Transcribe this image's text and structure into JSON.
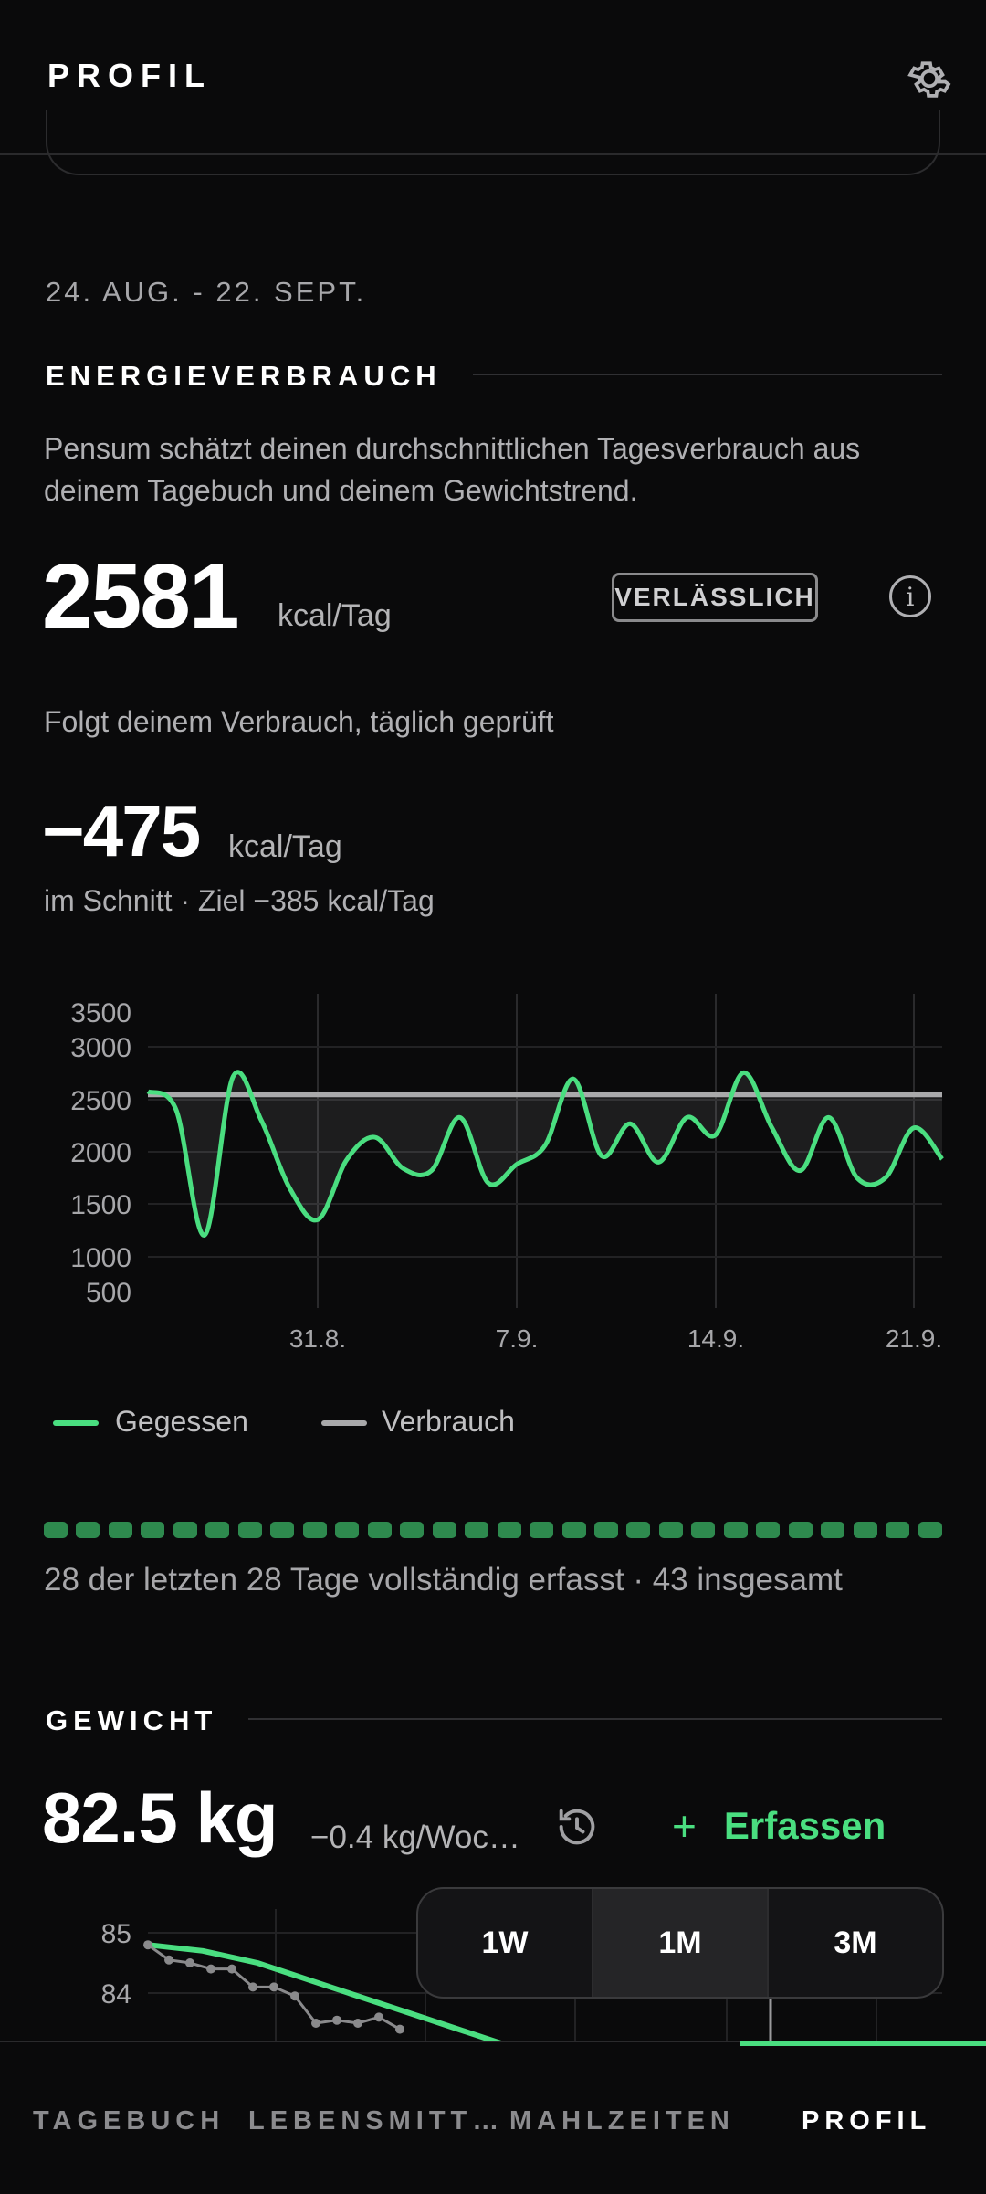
{
  "header": {
    "title": "PROFIL"
  },
  "period": {
    "range": "24. AUG. - 22. SEPT."
  },
  "energy": {
    "section_title": "ENERGIEVERBRAUCH",
    "description": "Pensum schätzt deinen durchschnittlichen Tagesverbrauch aus deinem Tagebuch und deinem Gewichtstrend.",
    "value": "2581",
    "unit": "kcal/Tag",
    "badge": "VERLÄSSLICH",
    "info_icon": "i",
    "tracking_text": "Folgt deinem Verbrauch, täglich geprüft",
    "deficit_value": "−475",
    "deficit_unit": "kcal/Tag",
    "deficit_caption": "im Schnitt · Ziel −385 kcal/Tag"
  },
  "chart_data": [
    {
      "type": "line",
      "y_ticks": [
        "3500",
        "3000",
        "2500",
        "2000",
        "1500",
        "1000",
        "500"
      ],
      "x_ticks": [
        "31.8.",
        "7.9.",
        "14.9.",
        "21.9."
      ],
      "series": [
        {
          "name": "Gegessen",
          "color": "#4ade80",
          "values": [
            2580,
            2400,
            1200,
            2720,
            2300,
            1650,
            1350,
            1920,
            2140,
            1840,
            1820,
            2330,
            1700,
            1880,
            2060,
            2700,
            1960,
            2270,
            1900,
            2330,
            2160,
            2760,
            2230,
            1820,
            2330,
            1750,
            1750,
            2230,
            1930
          ]
        },
        {
          "name": "Verbrauch",
          "color": "#a9a9ab",
          "values": [
            2550,
            2550,
            2550,
            2550,
            2550,
            2550,
            2550,
            2550,
            2550,
            2550,
            2550,
            2550,
            2550,
            2550,
            2550,
            2550,
            2550,
            2550,
            2550,
            2550,
            2550,
            2550,
            2550,
            2550,
            2550,
            2550,
            2550,
            2550,
            2550
          ]
        }
      ],
      "legend": [
        "Gegessen",
        "Verbrauch"
      ]
    },
    {
      "type": "line",
      "y_ticks": [
        "85",
        "84"
      ],
      "series": [
        {
          "name": "Trend",
          "color": "#4ade80",
          "values": [
            84.8,
            84.7,
            84.5,
            84.2,
            83.9,
            83.6,
            83.3,
            83.0
          ]
        },
        {
          "name": "Gewicht",
          "color": "#8a8a8c",
          "values": [
            84.8,
            84.55,
            84.5,
            84.4,
            84.4,
            84.1,
            84.1,
            83.95,
            83.5,
            83.55,
            83.5,
            83.6,
            83.4
          ]
        }
      ]
    }
  ],
  "completeness": {
    "days": 28,
    "text": "28 der letzten 28 Tage vollständig erfasst · 43 insgesamt"
  },
  "weight": {
    "section_title": "GEWICHT",
    "value": "82.5 kg",
    "rate": "−0.4 kg/Woc…",
    "add_label": "Erfassen",
    "ranges": [
      "1W",
      "1M",
      "3M"
    ],
    "active_range": "1M"
  },
  "nav": {
    "items": [
      "TAGEBUCH",
      "LEBENSMITT…",
      "MAHLZEITEN",
      "PROFIL"
    ],
    "active": "PROFIL"
  },
  "colors": {
    "accent": "#4ade80",
    "background": "#0a0a0b"
  }
}
